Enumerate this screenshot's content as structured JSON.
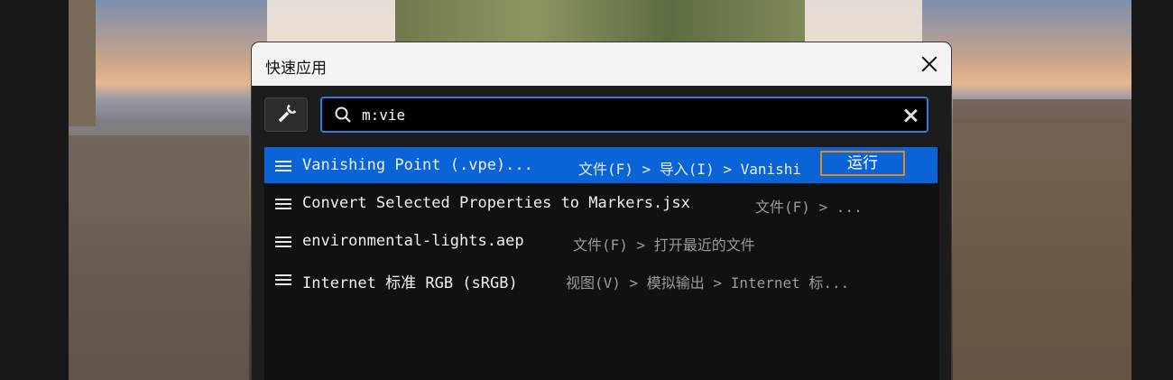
{
  "dialog": {
    "title": "快速应用"
  },
  "search": {
    "value": "m:vie"
  },
  "results": [
    {
      "name": "Vanishing Point (.vpe)...",
      "path": "文件(F) > 导入(I) > Vanishi",
      "selected": true,
      "action_label": "运行"
    },
    {
      "name": "Convert Selected Properties to Markers.jsx",
      "path": "文件(F) > ...",
      "selected": false
    },
    {
      "name": "environmental-lights.aep",
      "path": "文件(F) > 打开最近的文件",
      "selected": false
    },
    {
      "name": "Internet 标准 RGB (sRGB)",
      "path": "视图(V) > 模拟输出 > Internet 标...",
      "selected": false
    }
  ],
  "icons": {
    "tool": "wrench-icon",
    "search": "search-icon",
    "clear": "clear-icon",
    "close": "close-icon",
    "row": "menu-lines-icon"
  },
  "colors": {
    "accent": "#0a64d8",
    "search_border": "#2f7dd8",
    "run_button_border": "#e08a1e"
  }
}
